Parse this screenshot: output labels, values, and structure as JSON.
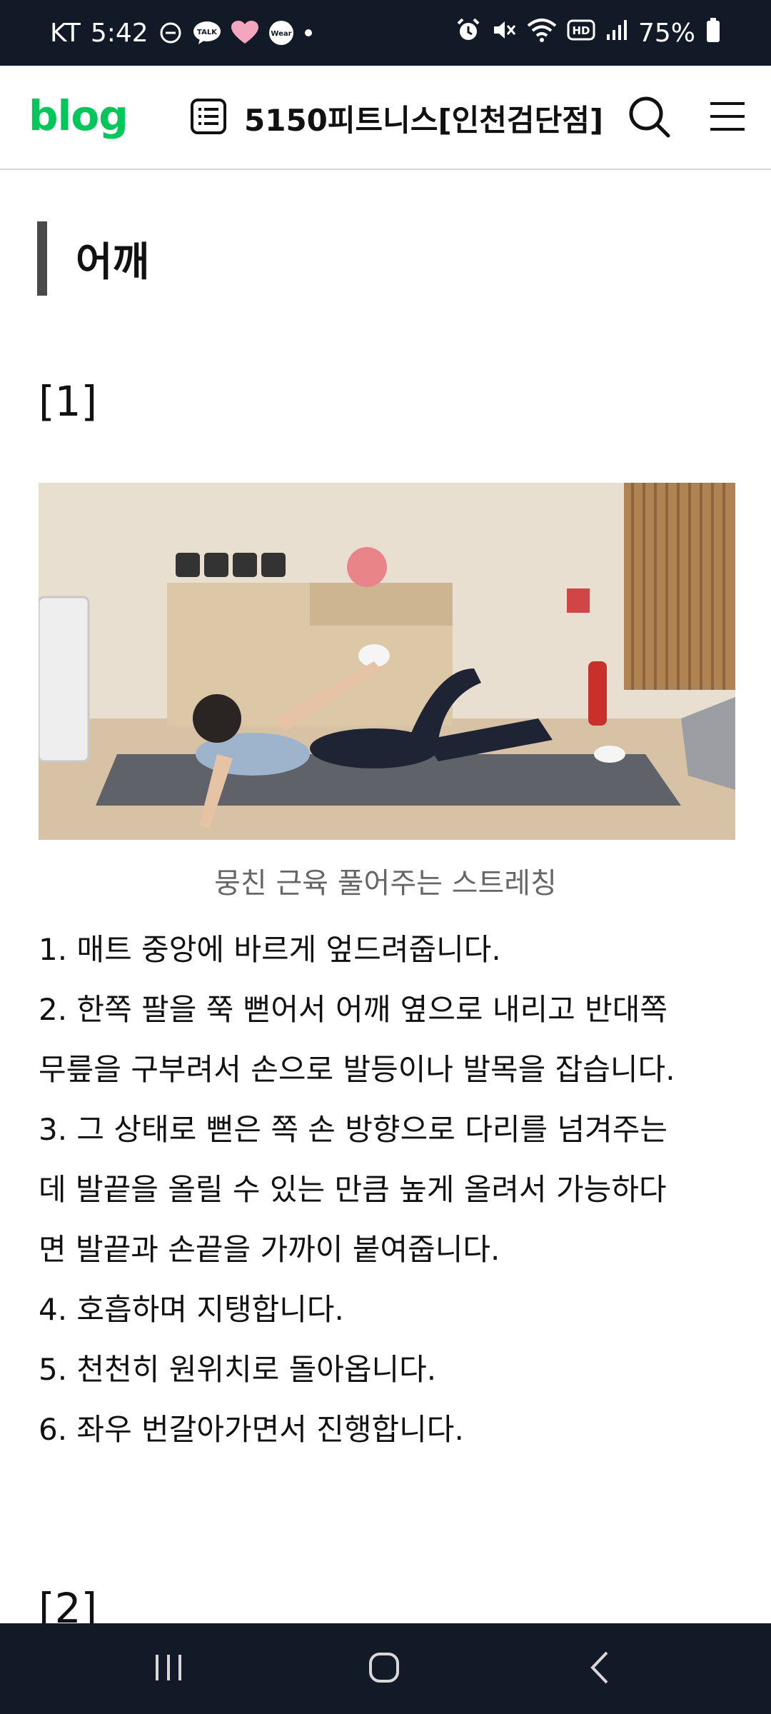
{
  "status_bar": {
    "carrier": "KT",
    "time": "5:42",
    "left_icons": [
      "minus-circle-icon",
      "talk-icon",
      "heart-icon",
      "wear-icon",
      "dot-icon"
    ],
    "talk_label": "TALK",
    "wear_label": "Wear",
    "right_icons": [
      "alarm-icon",
      "mute-icon",
      "wifi-icon",
      "hd-icon",
      "signal-icon"
    ],
    "hd_label": "HD",
    "battery": "75%"
  },
  "header": {
    "logo": "blog",
    "blog_name": "5150피트니스[인천검단점]",
    "icons": [
      "list-icon",
      "search-icon",
      "menu-icon"
    ],
    "brand_color": "#03c75a"
  },
  "content": {
    "section_title": "어깨",
    "item_number": "[1]",
    "photo_caption": "뭉친 근육 풀어주는 스트레칭",
    "steps": [
      "1. 매트 중앙에 바르게 엎드려줍니다.",
      "2. 한쪽 팔을 쭉 뻗어서 어깨 옆으로 내리고 반대쪽\n무릎을 구부려서 손으로 발등이나 발목을 잡습니다.",
      "3. 그 상태로 뻗은 쪽 손 방향으로 다리를 넘겨주는\n데 발끝을 올릴 수 있는 만큼 높게 올려서 가능하다\n면 발끝과 손끝을 가까이 붙여줍니다.",
      "4. 호흡하며 지탱합니다.",
      "5. 천천히 원위치로 돌아옵니다.",
      "6. 좌우 번갈아가면서 진행합니다."
    ],
    "next_item_number": "[2]"
  },
  "nav_bar": {
    "icons": [
      "recent-apps-icon",
      "home-icon",
      "back-icon"
    ]
  }
}
